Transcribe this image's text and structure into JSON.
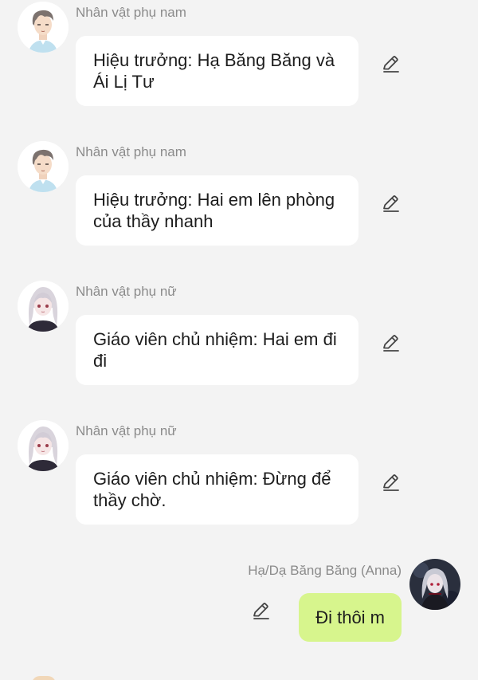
{
  "messages": [
    {
      "sender": "Nhân vật phụ nam",
      "avatar": "male-npc-avatar",
      "text": "Hiệu trưởng: Hạ Băng Băng và Ái Lị Tư",
      "action_icon": "edit-pencil-icon"
    },
    {
      "sender": "Nhân vật phụ nam",
      "avatar": "male-npc-avatar",
      "text": "Hiệu trưởng: Hai em lên phòng của thầy nhanh",
      "action_icon": "edit-pencil-icon"
    },
    {
      "sender": "Nhân vật phụ nữ",
      "avatar": "female-npc-avatar",
      "text": "Giáo viên chủ nhiệm: Hai em đi đi",
      "action_icon": "edit-pencil-icon"
    },
    {
      "sender": "Nhân vật phụ nữ",
      "avatar": "female-npc-avatar",
      "text": "Giáo viên chủ nhiệm: Đừng để thầy chờ.",
      "action_icon": "edit-pencil-icon"
    },
    {
      "sender": "Hạ/Dạ Băng Băng (Anna)",
      "avatar": "user-character-avatar",
      "text": "Đi thôi m",
      "action_icon": "edit-pencil-icon",
      "own": true
    }
  ],
  "colors": {
    "background": "#f3f3f3",
    "bubble": "#ffffff",
    "own_bubble": "#d7f58d",
    "sender_text": "#8b8b8b",
    "message_text": "#1d1d1d"
  }
}
